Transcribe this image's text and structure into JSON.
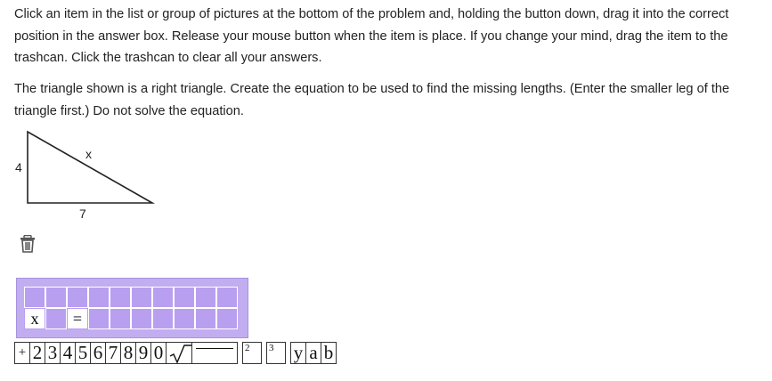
{
  "instructions": "Click an item in the list or group of pictures at the bottom of the problem and, holding the button down, drag it into the correct position in the answer box. Release your mouse button when the item is place. If you change your mind, drag the item to the trashcan. Click the trashcan to clear all your answers.",
  "prompt": "The triangle shown is a right triangle. Create the equation to be used to find the missing lengths. (Enter the smaller leg of the triangle first.) Do not solve the equation.",
  "triangle": {
    "left_label": "4",
    "hyp_label": "x",
    "bottom_label": "7"
  },
  "trash": {
    "icon": "trash-icon"
  },
  "answer_box": {
    "row1": [
      "",
      "",
      "",
      "",
      "",
      "",
      "",
      "",
      "",
      ""
    ],
    "row2": [
      "x",
      "",
      "=",
      "",
      "",
      "",
      "",
      "",
      "",
      ""
    ]
  },
  "palette": {
    "tiles": [
      "+",
      "2",
      "3",
      "4",
      "5",
      "6",
      "7",
      "8",
      "9",
      "0"
    ],
    "sqrt": "√",
    "superscripts": [
      "2",
      "3"
    ],
    "variables": [
      "y",
      "a",
      "b"
    ]
  },
  "colors": {
    "answer_bg": "#c2adf0",
    "cell_bg": "#b89ff0"
  }
}
